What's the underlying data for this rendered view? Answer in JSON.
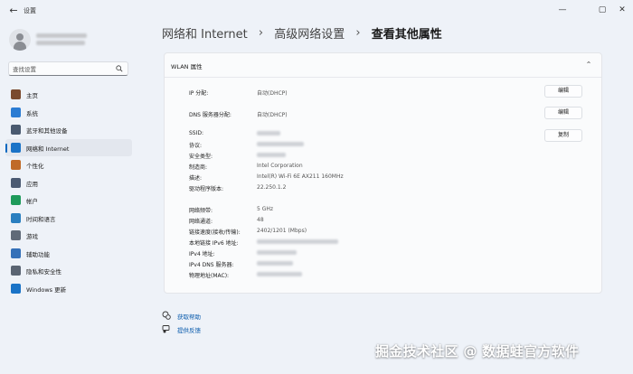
{
  "window": {
    "title": "设置",
    "back_icon": "back-arrow-icon",
    "min_icon": "minimize-icon",
    "max_icon": "maximize-icon",
    "close_icon": "close-icon"
  },
  "sidebar": {
    "search_placeholder": "查找设置",
    "items": [
      {
        "label": "主页",
        "icon": "home-icon",
        "color": "#7a4a2e"
      },
      {
        "label": "系统",
        "icon": "system-icon",
        "color": "#2b7cd3"
      },
      {
        "label": "蓝牙和其他设备",
        "icon": "bluetooth-devices-icon",
        "color": "#4a5a70"
      },
      {
        "label": "网络和 Internet",
        "icon": "wifi-icon",
        "color": "#1a73c7",
        "active": true
      },
      {
        "label": "个性化",
        "icon": "brush-icon",
        "color": "#c06a28"
      },
      {
        "label": "应用",
        "icon": "apps-icon",
        "color": "#4b5a72"
      },
      {
        "label": "帐户",
        "icon": "account-icon",
        "color": "#1e9a5a"
      },
      {
        "label": "时间和语言",
        "icon": "globe-clock-icon",
        "color": "#2a7fc0"
      },
      {
        "label": "游戏",
        "icon": "gamepad-icon",
        "color": "#606a78"
      },
      {
        "label": "辅助功能",
        "icon": "accessibility-icon",
        "color": "#3470b8"
      },
      {
        "label": "隐私和安全性",
        "icon": "shield-icon",
        "color": "#5a6472"
      },
      {
        "label": "Windows 更新",
        "icon": "update-icon",
        "color": "#1a73c7"
      }
    ]
  },
  "breadcrumb": [
    "网络和 Internet",
    "高级网络设置",
    "查看其他属性"
  ],
  "card": {
    "title": "WLAN 属性",
    "ip_assign_label": "IP 分配:",
    "ip_assign_value": "自动(DHCP)",
    "dns_assign_label": "DNS 服务器分配:",
    "dns_assign_value": "自动(DHCP)",
    "edit_label": "编辑",
    "copy_label": "复制",
    "props": {
      "ssid_label": "SSID:",
      "protocol_label": "协议:",
      "security_label": "安全类型:",
      "manufacturer_label": "制造商:",
      "manufacturer_value": "Intel Corporation",
      "description_label": "描述:",
      "description_value": "Intel(R) Wi-Fi 6E AX211 160MHz",
      "driver_label": "驱动程序版本:",
      "driver_value": "22.250.1.2",
      "band_label": "网络频带:",
      "band_value": "5 GHz",
      "channel_label": "网络通道:",
      "channel_value": "48",
      "speed_label": "链接速度(接收/传输):",
      "speed_value": "2402/1201 (Mbps)",
      "ipv6_label": "本地链接 IPv6 地址:",
      "ipv4_label": "IPv4 地址:",
      "ipv4dns_label": "IPv4 DNS 服务器:",
      "mac_label": "物理地址(MAC):"
    }
  },
  "help": {
    "get_help": "获取帮助",
    "get_help_icon": "help-icon",
    "feedback": "提供反馈",
    "feedback_icon": "feedback-icon"
  },
  "watermark": "掘金技术社区 @ 数据蛙官方软件"
}
